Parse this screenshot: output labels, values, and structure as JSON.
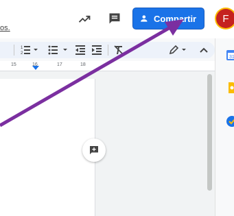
{
  "header": {
    "partial_text": "os.",
    "activity_icon": "trending-up-icon",
    "comments_icon": "comment-icon",
    "share_label": "Compartir",
    "avatar_initial": "F"
  },
  "toolbar": {
    "items": [
      "numbered-list-icon",
      "bulleted-list-icon",
      "decrease-indent-icon",
      "increase-indent-icon",
      "clear-formatting-icon",
      "edit-mode-icon",
      "collapse-icon"
    ]
  },
  "ruler": {
    "ticks": [
      "15",
      "16",
      "17",
      "18"
    ]
  },
  "side_panel": {
    "apps": [
      "calendar-icon",
      "keep-icon",
      "tasks-icon"
    ]
  },
  "colors": {
    "accent": "#1a73e8",
    "arrow": "#7b2fa0",
    "avatar": "#c5221f"
  }
}
